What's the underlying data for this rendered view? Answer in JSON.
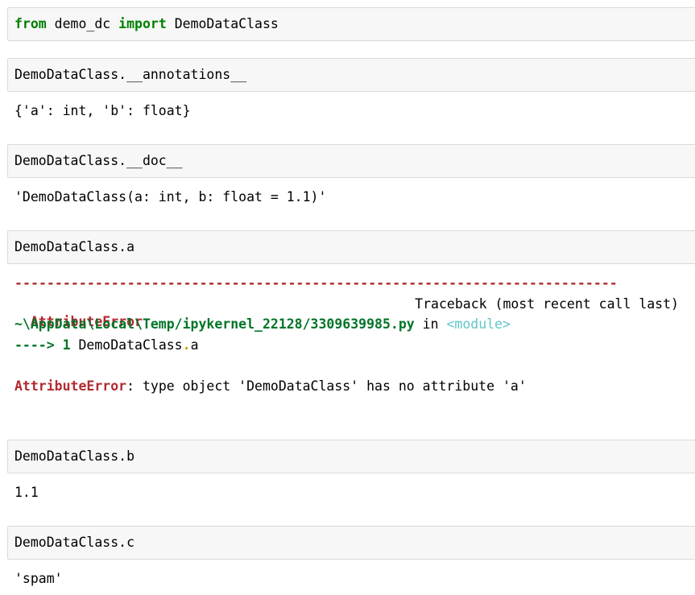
{
  "cells": [
    {
      "keyword_from": "from",
      "module": " demo_dc ",
      "keyword_import": "import",
      "name": " DemoDataClass"
    },
    {
      "code": "DemoDataClass.__annotations__",
      "output": "{'a': int, 'b': float}"
    },
    {
      "code": "DemoDataClass.__doc__",
      "output": "'DemoDataClass(a: int, b: float = 1.1)'"
    },
    {
      "code": "DemoDataClass.a"
    },
    {
      "code": "DemoDataClass.b",
      "output": "1.1"
    },
    {
      "code": "DemoDataClass.c",
      "output": "'spam'"
    }
  ],
  "traceback": {
    "dashes": "---------------------------------------------------------------------------",
    "error_name": "AttributeError",
    "header_right": "Traceback (most recent call last)",
    "file_path": "~\\AppData\\Local\\Temp/ipykernel_22128/3309639985.py",
    "in_text": " in ",
    "module_ref": "<module>",
    "arrow": "----> 1",
    "line_code_prefix": " DemoDataClass",
    "line_code_dot": ".",
    "line_code_suffix": "a",
    "final_error_name": "AttributeError",
    "final_message": ": type object 'DemoDataClass' has no attribute 'a'"
  }
}
